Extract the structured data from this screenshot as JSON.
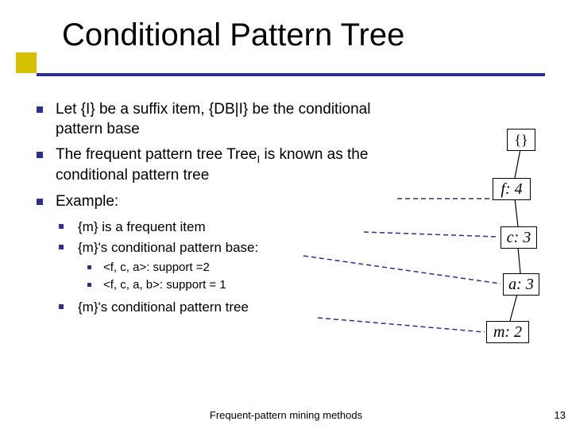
{
  "title": "Conditional Pattern Tree",
  "bullets": {
    "b1": "Let {I} be a suffix item, {DB|I} be the conditional pattern base",
    "b2a": "The frequent pattern tree Tree",
    "b2sub": "I",
    "b2b": " is known as the conditional pattern tree",
    "b3": "Example:",
    "s1": "{m} is a frequent item",
    "s2": "{m}'s conditional pattern base:",
    "s2a": "<f, c, a>: support =2",
    "s2b": "<f, c, a, b>: support = 1",
    "s3": "{m}'s conditional pattern tree"
  },
  "tree": {
    "root": "{}",
    "f": "f: 4",
    "c": "c: 3",
    "a": "a: 3",
    "m": "m: 2"
  },
  "footer": "Frequent-pattern mining methods",
  "page": "13"
}
